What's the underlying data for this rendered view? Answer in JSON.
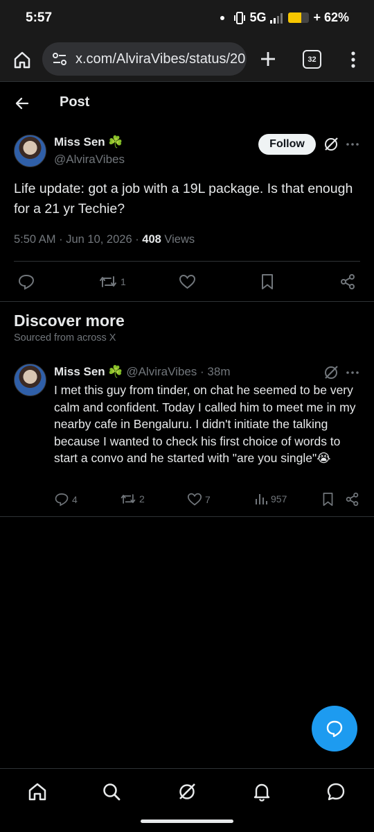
{
  "status_bar": {
    "time": "5:57",
    "network": "5G",
    "battery_percent": "62%",
    "battery_level": 0.62
  },
  "browser": {
    "url": "x.com/AlviraVibes/status/20",
    "tab_count": "32"
  },
  "header": {
    "title": "Post"
  },
  "post": {
    "author_name": "Miss Sen ☘️",
    "author_handle": "@AlviraVibes",
    "follow_label": "Follow",
    "text": "Life update: got a job with a 19L package. Is that enough for a 21 yr Techie?",
    "time": "5:50 AM · Jun 10, 2026 · ",
    "views_count": "408",
    "views_label": " Views",
    "reposts": "1"
  },
  "discover": {
    "title": "Discover more",
    "subtitle": "Sourced from across X"
  },
  "tweet": {
    "author_name": "Miss Sen ☘️",
    "author_handle": " @AlviraVibes · 38m",
    "text": "I met this guy from tinder, on chat he seemed to be very calm and confident. Today I called him to meet me in my nearby cafe in Bengaluru. I didn't initiate the talking because I wanted to check his first choice of words to start a convo and he started with \"are you single\"😭",
    "replies": "4",
    "reposts": "2",
    "likes": "7",
    "views": "957"
  },
  "colors": {
    "accent": "#1d9bf0",
    "muted_text": "#71767b",
    "divider": "#2f3336",
    "background": "#000000"
  },
  "icons": {
    "nav": [
      "home-icon",
      "search-icon",
      "grok-icon",
      "notifications-icon",
      "messages-icon"
    ]
  }
}
